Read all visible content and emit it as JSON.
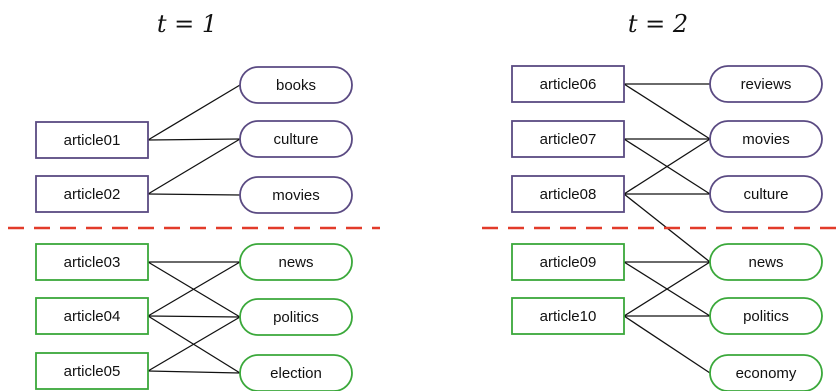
{
  "colors": {
    "purple": "#5a4a82",
    "green": "#3aa83a",
    "divider": "#e23b2a"
  },
  "panels": [
    {
      "title": "t = 1",
      "articles": [
        {
          "id": "a01",
          "label": "article01",
          "group": "purple"
        },
        {
          "id": "a02",
          "label": "article02",
          "group": "purple"
        },
        {
          "id": "a03",
          "label": "article03",
          "group": "green"
        },
        {
          "id": "a04",
          "label": "article04",
          "group": "green"
        },
        {
          "id": "a05",
          "label": "article05",
          "group": "green"
        }
      ],
      "tags": [
        {
          "id": "books",
          "label": "books",
          "group": "purple"
        },
        {
          "id": "culture",
          "label": "culture",
          "group": "purple"
        },
        {
          "id": "movies",
          "label": "movies",
          "group": "purple"
        },
        {
          "id": "news",
          "label": "news",
          "group": "green"
        },
        {
          "id": "politics",
          "label": "politics",
          "group": "green"
        },
        {
          "id": "election",
          "label": "election",
          "group": "green"
        }
      ],
      "edges": [
        [
          "a01",
          "books"
        ],
        [
          "a01",
          "culture"
        ],
        [
          "a02",
          "culture"
        ],
        [
          "a02",
          "movies"
        ],
        [
          "a03",
          "news"
        ],
        [
          "a03",
          "politics"
        ],
        [
          "a04",
          "news"
        ],
        [
          "a04",
          "politics"
        ],
        [
          "a04",
          "election"
        ],
        [
          "a05",
          "politics"
        ],
        [
          "a05",
          "election"
        ]
      ]
    },
    {
      "title": "t = 2",
      "articles": [
        {
          "id": "a06",
          "label": "article06",
          "group": "purple"
        },
        {
          "id": "a07",
          "label": "article07",
          "group": "purple"
        },
        {
          "id": "a08",
          "label": "article08",
          "group": "purple"
        },
        {
          "id": "a09",
          "label": "article09",
          "group": "green"
        },
        {
          "id": "a10",
          "label": "article10",
          "group": "green"
        }
      ],
      "tags": [
        {
          "id": "reviews",
          "label": "reviews",
          "group": "purple"
        },
        {
          "id": "movies",
          "label": "movies",
          "group": "purple"
        },
        {
          "id": "culture",
          "label": "culture",
          "group": "purple"
        },
        {
          "id": "news",
          "label": "news",
          "group": "green"
        },
        {
          "id": "politics",
          "label": "politics",
          "group": "green"
        },
        {
          "id": "economy",
          "label": "economy",
          "group": "green"
        }
      ],
      "edges": [
        [
          "a06",
          "reviews"
        ],
        [
          "a06",
          "movies"
        ],
        [
          "a07",
          "movies"
        ],
        [
          "a07",
          "culture"
        ],
        [
          "a08",
          "movies"
        ],
        [
          "a08",
          "culture"
        ],
        [
          "a08",
          "news"
        ],
        [
          "a09",
          "news"
        ],
        [
          "a09",
          "politics"
        ],
        [
          "a10",
          "news"
        ],
        [
          "a10",
          "politics"
        ],
        [
          "a10",
          "economy"
        ]
      ]
    }
  ]
}
